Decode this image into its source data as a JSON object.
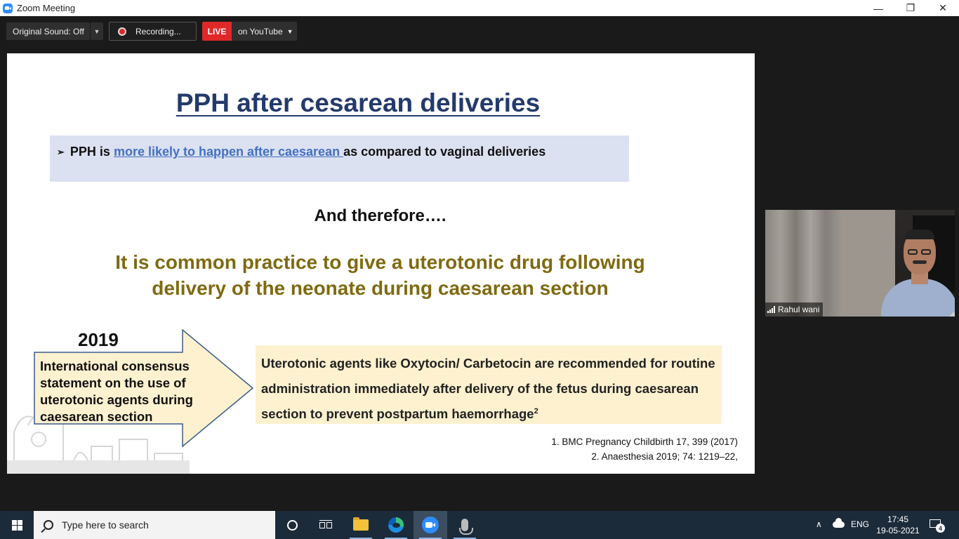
{
  "window": {
    "title": "Zoom Meeting",
    "controls": {
      "minimize": "—",
      "restore": "❐",
      "close": "✕"
    }
  },
  "toolbar": {
    "original_sound": "Original Sound: Off",
    "recording": "Recording...",
    "live_badge": "LIVE",
    "stream_target": "on YouTube"
  },
  "slide": {
    "title": "PPH after cesarean deliveries",
    "bullet": {
      "prefix": "PPH is ",
      "link": "more likely to happen after caesarean ",
      "suffix": "as compared to vaginal deliveries"
    },
    "therefore": "And therefore….",
    "common_line1": "It is common practice to give a uterotonic drug following",
    "common_line2": "delivery of the neonate during caesarean section",
    "year": "2019",
    "arrow_text": "International consensus statement on the use of uterotonic agents during caesarean section",
    "recommendation": "Uterotonic agents like Oxytocin/ Carbetocin are recommended for routine administration immediately after delivery of the fetus during caesarean section to prevent postpartum haemorrhage",
    "recommendation_sup": "2",
    "ref1": "1. BMC Pregnancy Childbirth 17, 399 (2017)",
    "ref2": "2. Anaesthesia 2019; 74: 1219–22,",
    "colors": {
      "title": "#243a6b",
      "link": "#4470c4",
      "common": "#7f6a11",
      "bullet_bg": "#dbe1f1",
      "reco_bg": "#fdf1cf",
      "arrow_fill": "#fdf1cf",
      "arrow_stroke": "#3b5b8f"
    }
  },
  "video": {
    "participant": "Rahul wani"
  },
  "taskbar": {
    "search_placeholder": "Type here to search",
    "language": "ENG",
    "time": "17:45",
    "date": "19-05-2021",
    "notification_count": "4",
    "pinned": [
      "task-view",
      "file-explorer",
      "edge",
      "zoom",
      "voice-recorder"
    ]
  }
}
